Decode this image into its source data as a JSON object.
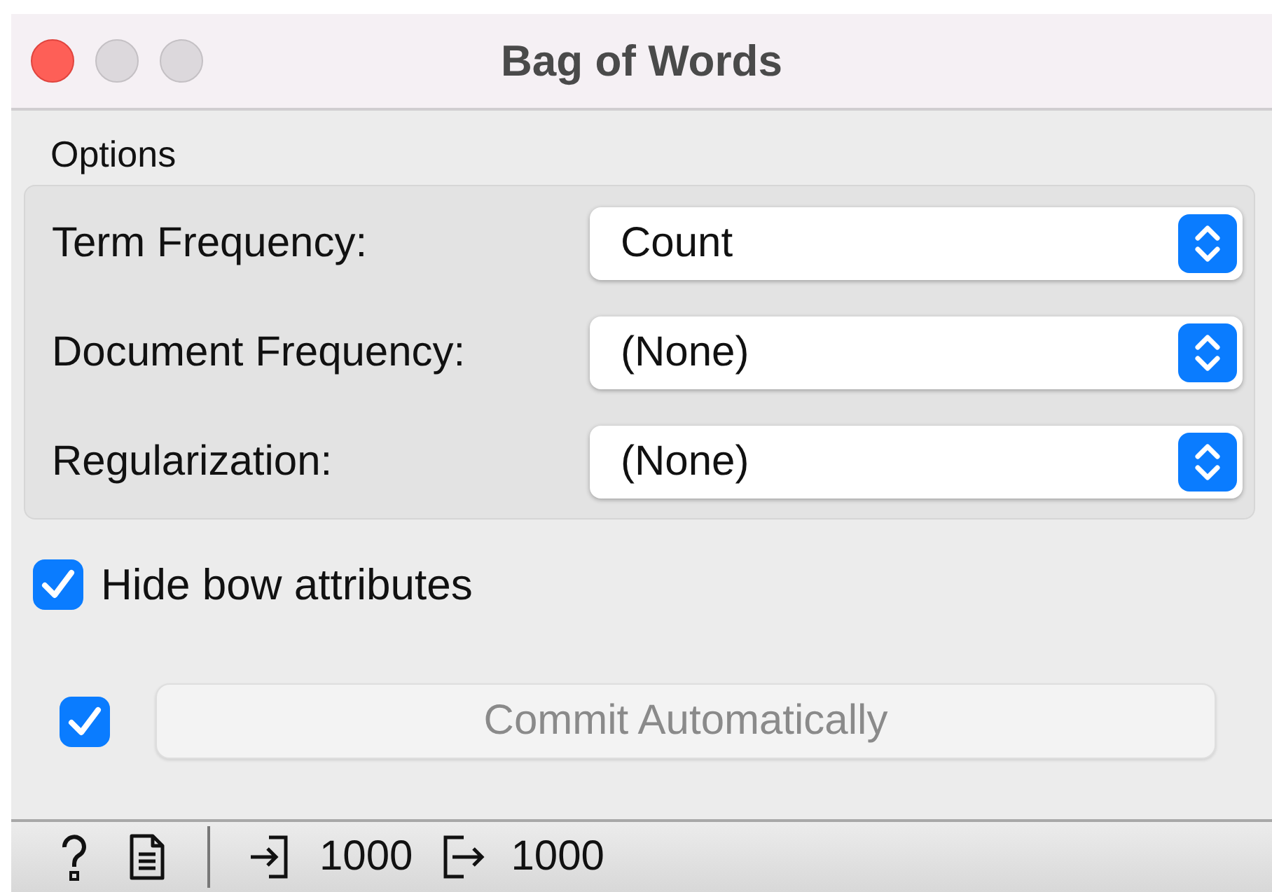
{
  "window": {
    "title": "Bag of Words"
  },
  "options": {
    "title": "Options",
    "rows": [
      {
        "label": "Term Frequency:",
        "value": "Count"
      },
      {
        "label": "Document Frequency:",
        "value": "(None)"
      },
      {
        "label": "Regularization:",
        "value": "(None)"
      }
    ]
  },
  "hide_bow": {
    "label": "Hide bow attributes",
    "checked": true
  },
  "commit": {
    "auto_checked": true,
    "label": "Commit Automatically",
    "disabled": true
  },
  "status_bar": {
    "input_count": "1000",
    "output_count": "1000"
  }
}
